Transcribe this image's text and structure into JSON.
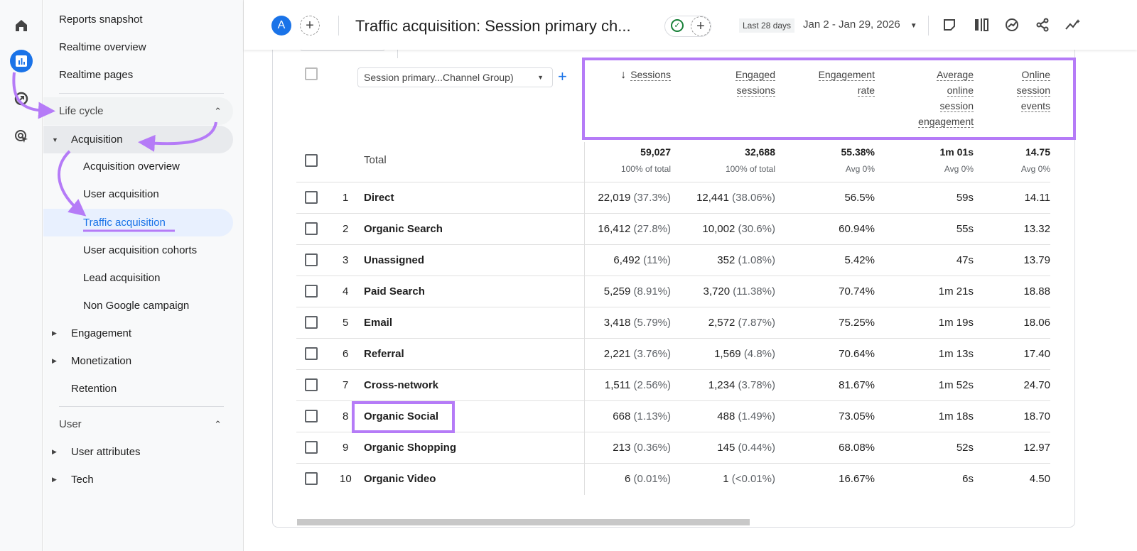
{
  "rail": {
    "items": [
      {
        "icon": "home-icon"
      },
      {
        "icon": "reports-icon",
        "active": true
      },
      {
        "icon": "explore-icon"
      },
      {
        "icon": "advertising-icon"
      }
    ]
  },
  "sidebar": {
    "top_items": [
      "Reports snapshot",
      "Realtime overview",
      "Realtime pages"
    ],
    "lifecycle": {
      "label": "Life cycle",
      "acquisition": {
        "label": "Acquisition",
        "children": [
          "Acquisition overview",
          "User acquisition",
          "Traffic acquisition",
          "User acquisition cohorts",
          "Lead acquisition",
          "Non Google campaign"
        ]
      },
      "others": [
        "Engagement",
        "Monetization",
        "Retention"
      ]
    },
    "user": {
      "label": "User",
      "children": [
        "User attributes",
        "Tech"
      ]
    },
    "selected": "Traffic acquisition"
  },
  "header": {
    "avatar": "A",
    "title": "Traffic acquisition: Session primary ch...",
    "date_badge": "Last 28 days",
    "date_range": "Jan 2 - Jan 29, 2026"
  },
  "table": {
    "dimension": "Session primary...Channel Group)",
    "columns": [
      [
        "Sessions"
      ],
      [
        "Engaged",
        "sessions"
      ],
      [
        "Engagement",
        "rate"
      ],
      [
        "Average",
        "online",
        "session",
        "engagement"
      ],
      [
        "Online",
        "session",
        "events"
      ]
    ],
    "total": {
      "label": "Total",
      "values": [
        "59,027",
        "32,688",
        "55.38%",
        "1m 01s",
        "14.75"
      ],
      "subs": [
        "100% of total",
        "100% of total",
        "Avg 0%",
        "Avg 0%",
        "Avg 0%"
      ]
    },
    "rows": [
      {
        "rank": "1",
        "name": "Direct",
        "sessions": "22,019",
        "sessions_pct": "(37.3%)",
        "engaged": "12,441",
        "engaged_pct": "(38.06%)",
        "rate": "56.5%",
        "avg": "59s",
        "events": "14.11"
      },
      {
        "rank": "2",
        "name": "Organic Search",
        "sessions": "16,412",
        "sessions_pct": "(27.8%)",
        "engaged": "10,002",
        "engaged_pct": "(30.6%)",
        "rate": "60.94%",
        "avg": "55s",
        "events": "13.32"
      },
      {
        "rank": "3",
        "name": "Unassigned",
        "sessions": "6,492",
        "sessions_pct": "(11%)",
        "engaged": "352",
        "engaged_pct": "(1.08%)",
        "rate": "5.42%",
        "avg": "47s",
        "events": "13.79"
      },
      {
        "rank": "4",
        "name": "Paid Search",
        "sessions": "5,259",
        "sessions_pct": "(8.91%)",
        "engaged": "3,720",
        "engaged_pct": "(11.38%)",
        "rate": "70.74%",
        "avg": "1m 21s",
        "events": "18.88"
      },
      {
        "rank": "5",
        "name": "Email",
        "sessions": "3,418",
        "sessions_pct": "(5.79%)",
        "engaged": "2,572",
        "engaged_pct": "(7.87%)",
        "rate": "75.25%",
        "avg": "1m 19s",
        "events": "18.06"
      },
      {
        "rank": "6",
        "name": "Referral",
        "sessions": "2,221",
        "sessions_pct": "(3.76%)",
        "engaged": "1,569",
        "engaged_pct": "(4.8%)",
        "rate": "70.64%",
        "avg": "1m 13s",
        "events": "17.40"
      },
      {
        "rank": "7",
        "name": "Cross-network",
        "sessions": "1,511",
        "sessions_pct": "(2.56%)",
        "engaged": "1,234",
        "engaged_pct": "(3.78%)",
        "rate": "81.67%",
        "avg": "1m 52s",
        "events": "24.70"
      },
      {
        "rank": "8",
        "name": "Organic Social",
        "sessions": "668",
        "sessions_pct": "(1.13%)",
        "engaged": "488",
        "engaged_pct": "(1.49%)",
        "rate": "73.05%",
        "avg": "1m 18s",
        "events": "18.70"
      },
      {
        "rank": "9",
        "name": "Organic Shopping",
        "sessions": "213",
        "sessions_pct": "(0.36%)",
        "engaged": "145",
        "engaged_pct": "(0.44%)",
        "rate": "68.08%",
        "avg": "52s",
        "events": "12.97"
      },
      {
        "rank": "10",
        "name": "Organic Video",
        "sessions": "6",
        "sessions_pct": "(0.01%)",
        "engaged": "1",
        "engaged_pct": "(<0.01%)",
        "rate": "16.67%",
        "avg": "6s",
        "events": "4.50"
      }
    ]
  },
  "colors": {
    "accent": "#1a73e8",
    "highlight": "#b57bf7"
  }
}
